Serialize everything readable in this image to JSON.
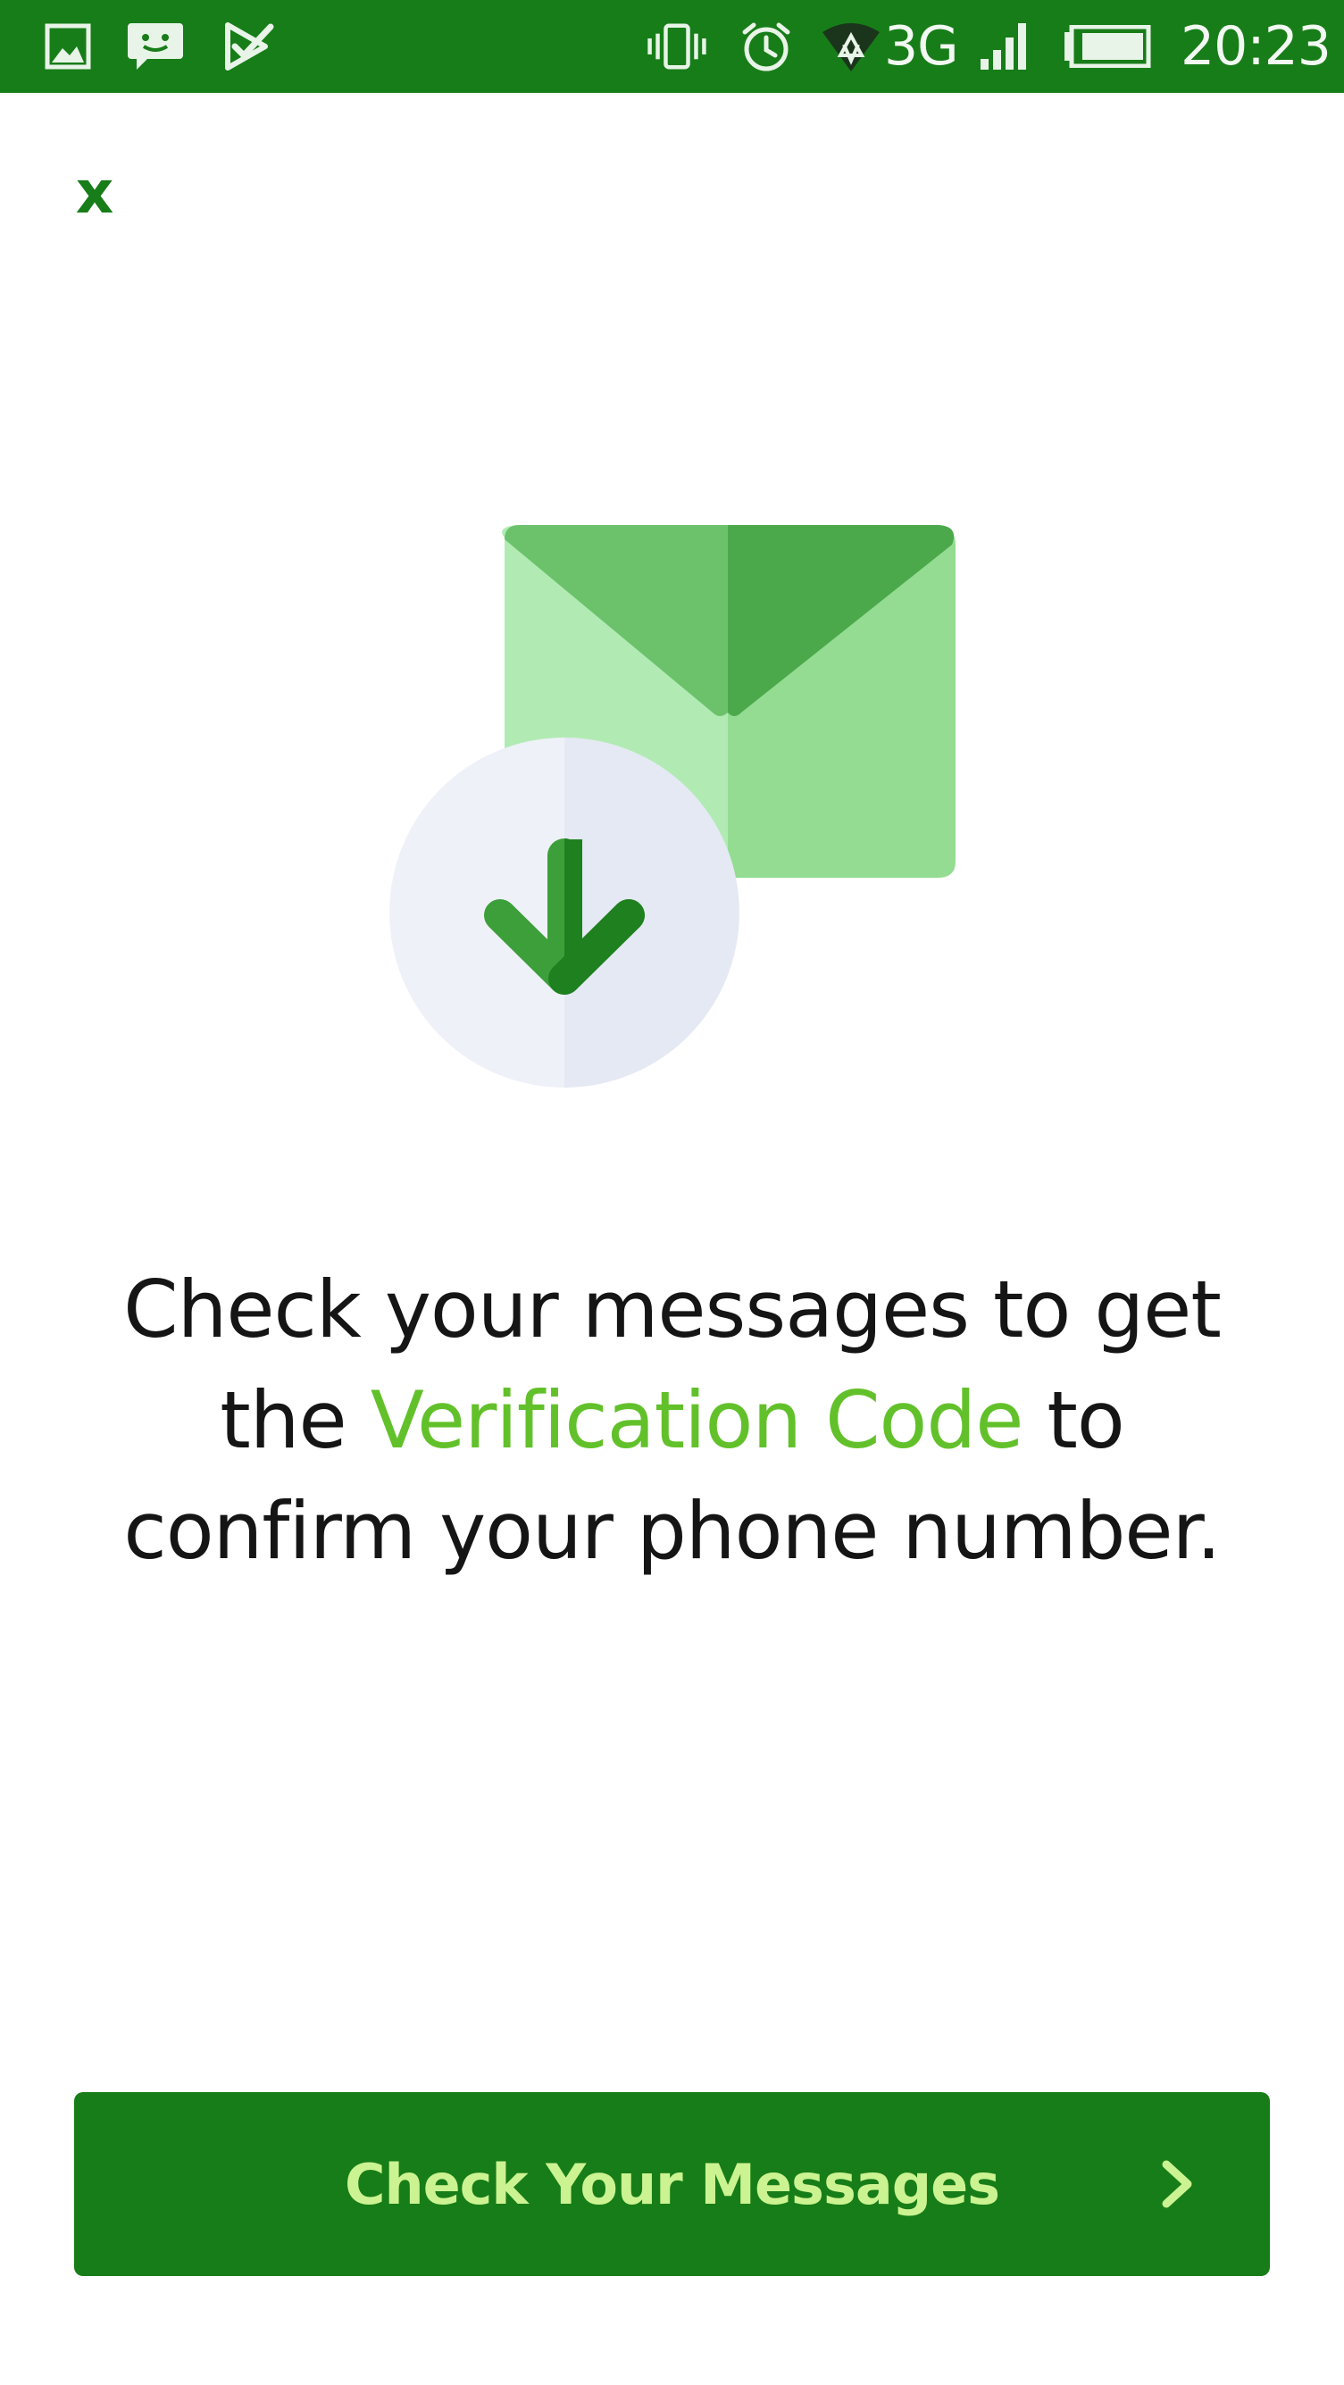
{
  "status_bar": {
    "network": "3G",
    "time": "20:23",
    "icons": [
      "gallery-icon",
      "chat-icon",
      "task-icon",
      "vibrate-icon",
      "alarm-icon",
      "wifi-icon",
      "signal-icon",
      "battery-icon"
    ]
  },
  "close": {
    "label": "x"
  },
  "message": {
    "part1": "Check your messages to get the",
    "highlight": "Verification Code",
    "part2": "to confirm your phone number."
  },
  "action": {
    "label": "Check Your Messages",
    "icon": "chevron-right-icon"
  },
  "colors": {
    "brand_green": "#177d18",
    "highlight_green": "#62c12a",
    "button_text": "#ccf391"
  }
}
